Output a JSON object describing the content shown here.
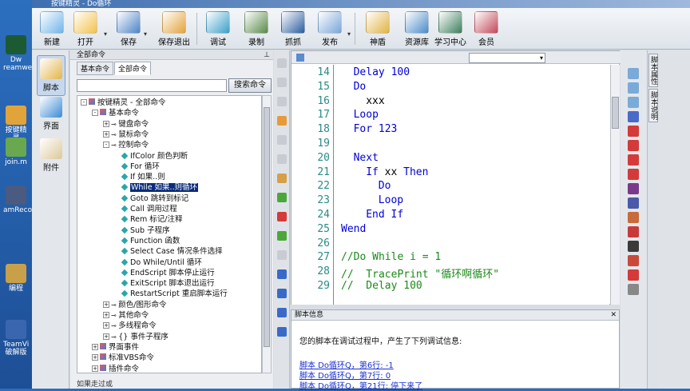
{
  "window": {
    "title": "按键精灵 - Do循环"
  },
  "desktop_icons": [
    {
      "name": "dreamweaver-icon",
      "label": "Dw\nreamwea"
    },
    {
      "name": "app-icon",
      "label": "按键精灵\n的动态"
    },
    {
      "name": "join-icon",
      "label": "join.m"
    },
    {
      "name": "recorder-icon",
      "label": "amRecor"
    },
    {
      "name": "edit-icon",
      "label": "编程"
    },
    {
      "name": "teamviewer-icon",
      "label": "TeamVi\n破解版"
    }
  ],
  "toolbar": {
    "items": [
      {
        "name": "new",
        "label": "新建"
      },
      {
        "name": "open",
        "label": "打开"
      },
      {
        "name": "save",
        "label": "保存"
      },
      {
        "name": "save-exit",
        "label": "保存退出"
      },
      {
        "name": "debug",
        "label": "调试"
      },
      {
        "name": "record",
        "label": "录制"
      },
      {
        "name": "capture",
        "label": "抓抓"
      },
      {
        "name": "publish",
        "label": "发布"
      },
      {
        "name": "shield",
        "label": "神盾"
      },
      {
        "name": "resources",
        "label": "资源库"
      },
      {
        "name": "learn",
        "label": "学习中心"
      },
      {
        "name": "member",
        "label": "会员"
      }
    ]
  },
  "leftbar": {
    "items": [
      "脚本",
      "界面",
      "附件"
    ]
  },
  "command_panel": {
    "header": "全部命令",
    "tabs": [
      "基本命令",
      "全部命令"
    ],
    "search_button": "搜索命令",
    "search_value": "",
    "bottom_label": "如果走过或"
  },
  "tree": [
    {
      "depth": 0,
      "exp": "-",
      "type": "folder",
      "label": "按键精灵 - 全部命令"
    },
    {
      "depth": 1,
      "exp": "-",
      "type": "folder",
      "label": "基本命令"
    },
    {
      "depth": 2,
      "exp": "+",
      "type": "node",
      "label": "键盘命令"
    },
    {
      "depth": 2,
      "exp": "+",
      "type": "node",
      "label": "鼠标命令"
    },
    {
      "depth": 2,
      "exp": "-",
      "type": "node",
      "label": "控制命令"
    },
    {
      "depth": 3,
      "exp": "",
      "type": "cmd",
      "label": "IfColor 颜色判断"
    },
    {
      "depth": 3,
      "exp": "",
      "type": "cmd",
      "label": "For 循环"
    },
    {
      "depth": 3,
      "exp": "",
      "type": "cmd",
      "label": "If 如果..则"
    },
    {
      "depth": 3,
      "exp": "",
      "type": "cmd",
      "label": "While 如果..则循环",
      "selected": true
    },
    {
      "depth": 3,
      "exp": "",
      "type": "cmd",
      "label": "Goto 跳转到标记"
    },
    {
      "depth": 3,
      "exp": "",
      "type": "cmd",
      "label": "Call 调用过程"
    },
    {
      "depth": 3,
      "exp": "",
      "type": "cmd",
      "label": "Rem 标记/注释"
    },
    {
      "depth": 3,
      "exp": "",
      "type": "cmd",
      "label": "Sub 子程序"
    },
    {
      "depth": 3,
      "exp": "",
      "type": "cmd",
      "label": "Function 函数"
    },
    {
      "depth": 3,
      "exp": "",
      "type": "cmd",
      "label": "Select Case 情况条件选择"
    },
    {
      "depth": 3,
      "exp": "",
      "type": "cmd",
      "label": "Do While/Until 循环"
    },
    {
      "depth": 3,
      "exp": "",
      "type": "cmd",
      "label": "EndScript 脚本停止运行"
    },
    {
      "depth": 3,
      "exp": "",
      "type": "cmd",
      "label": "ExitScript 脚本退出运行"
    },
    {
      "depth": 3,
      "exp": "",
      "type": "cmd",
      "label": "RestartScript 重启脚本运行"
    },
    {
      "depth": 2,
      "exp": "+",
      "type": "node",
      "label": "颜色/图形命令"
    },
    {
      "depth": 2,
      "exp": "+",
      "type": "node",
      "label": "其他命令"
    },
    {
      "depth": 2,
      "exp": "+",
      "type": "node",
      "label": "多线程命令"
    },
    {
      "depth": 2,
      "exp": "+",
      "type": "node",
      "label": "{} 事件子程序"
    },
    {
      "depth": 1,
      "exp": "+",
      "type": "folder",
      "label": "界面事件"
    },
    {
      "depth": 1,
      "exp": "+",
      "type": "folder",
      "label": "标准VBS命令"
    },
    {
      "depth": 1,
      "exp": "+",
      "type": "folder",
      "label": "插件命令"
    }
  ],
  "editor": {
    "lines": [
      {
        "n": "14",
        "indent": 2,
        "parts": [
          {
            "t": "Delay ",
            "c": "kw"
          },
          {
            "t": "100",
            "c": "kw"
          }
        ]
      },
      {
        "n": "15",
        "indent": 2,
        "parts": [
          {
            "t": "Do",
            "c": "kw"
          }
        ]
      },
      {
        "n": "16",
        "indent": 4,
        "parts": [
          {
            "t": "xxx",
            "c": "tx"
          }
        ]
      },
      {
        "n": "17",
        "indent": 2,
        "parts": [
          {
            "t": "Loop",
            "c": "kw"
          }
        ]
      },
      {
        "n": "18",
        "indent": 2,
        "parts": [
          {
            "t": "For 123",
            "c": "kw"
          }
        ]
      },
      {
        "n": "19",
        "indent": 0,
        "parts": []
      },
      {
        "n": "20",
        "indent": 2,
        "parts": [
          {
            "t": "Next",
            "c": "kw"
          }
        ]
      },
      {
        "n": "21",
        "indent": 4,
        "parts": [
          {
            "t": "If ",
            "c": "kw"
          },
          {
            "t": "xx ",
            "c": "tx"
          },
          {
            "t": "Then",
            "c": "kw"
          }
        ]
      },
      {
        "n": "22",
        "indent": 6,
        "parts": [
          {
            "t": "Do",
            "c": "kw"
          }
        ]
      },
      {
        "n": "23",
        "indent": 6,
        "parts": [
          {
            "t": "Loop",
            "c": "kw"
          }
        ]
      },
      {
        "n": "24",
        "indent": 4,
        "parts": [
          {
            "t": "End If",
            "c": "kw"
          }
        ]
      },
      {
        "n": "25",
        "indent": 0,
        "parts": [
          {
            "t": "Wend",
            "c": "kw"
          }
        ]
      },
      {
        "n": "26",
        "indent": 0,
        "parts": []
      },
      {
        "n": "27",
        "indent": 0,
        "parts": [
          {
            "t": "//Do While i = 1",
            "c": "cm"
          }
        ]
      },
      {
        "n": "28",
        "indent": 0,
        "parts": [
          {
            "t": "//  TracePrint \"循环啊循环\"",
            "c": "cm"
          }
        ]
      },
      {
        "n": "29",
        "indent": 0,
        "parts": [
          {
            "t": "//  Delay 100",
            "c": "cm"
          }
        ]
      }
    ]
  },
  "info": {
    "title": "脚本信息",
    "message": "您的脚本在调试过程中，产生了下列调试信息:",
    "links": [
      "脚本 Do循环Q，第6行: -1",
      "脚本 Do循环Q，第7行: 0",
      "脚本 Do循环Q，第21行: 停下来了"
    ]
  },
  "right_tabs": [
    "脚本属性",
    "脚本说明"
  ]
}
